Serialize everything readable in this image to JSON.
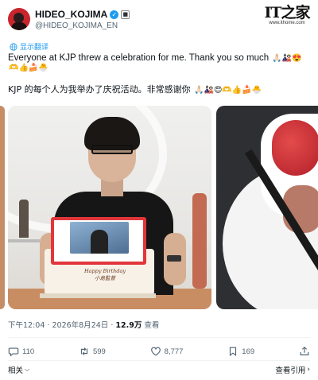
{
  "account": {
    "display_name": "HIDEO_KOJIMA",
    "handle": "@HIDEO_KOJIMA_EN",
    "verified_icon": "verified-check-icon",
    "badge_icon": "organization-badge-icon"
  },
  "watermark": {
    "logo": "IT之家",
    "url": "www.ithome.com"
  },
  "translate": {
    "label": "显示翻译",
    "icon": "globe-icon"
  },
  "tweet": {
    "text_en": "Everyone at KJP threw a celebration for me. Thank you so much",
    "emojis_en": "🙏🏻🎎😍",
    "emojis_en_line2": "🫶👍🍰🐣",
    "text_zh": "KJP 的每个人为我举办了庆祝活动。非常感谢你",
    "emojis_zh": "🙏🏻🎎😍🫶👍🍰🐣"
  },
  "photos": {
    "cake_text": "Happy Birthday\n小島監督"
  },
  "meta": {
    "time": "下午12:04",
    "date": "2026年8月24日",
    "views_count": "12.9万",
    "views_label": "查看",
    "separator": "·"
  },
  "actions": {
    "reply": {
      "count": "110",
      "icon": "reply-icon"
    },
    "retweet": {
      "count": "599",
      "icon": "retweet-icon"
    },
    "like": {
      "count": "8,777",
      "icon": "heart-icon"
    },
    "bookmark": {
      "count": "169",
      "icon": "bookmark-icon"
    },
    "share": {
      "icon": "share-icon"
    }
  },
  "footer": {
    "related_label": "相关",
    "quotes_label": "查看引用"
  },
  "colors": {
    "accent": "#1d9bf0",
    "secondary_text": "#536471",
    "primary_text": "#0f1419"
  }
}
